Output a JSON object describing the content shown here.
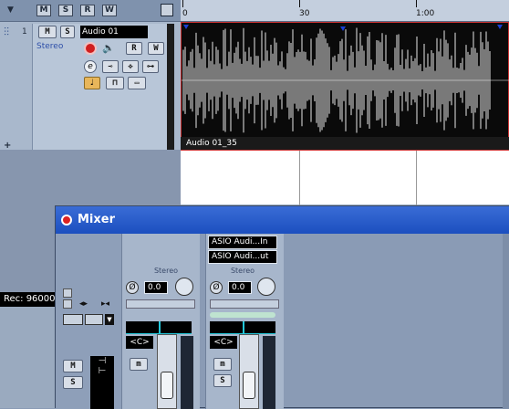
{
  "project": {
    "toolbar": {
      "buttons": [
        "M",
        "S",
        "R",
        "W"
      ]
    },
    "timeline": {
      "ticks": [
        "0",
        "30",
        "1:00"
      ]
    },
    "track": {
      "number": "1",
      "name": "Audio 01",
      "channel_type": "Stereo",
      "mute": "M",
      "solo": "S",
      "read": "R",
      "write": "W",
      "edit": "e"
    },
    "part_label": "Audio 01_35",
    "status": "Rec: 96000"
  },
  "mixer": {
    "title": "Mixer",
    "left_panel": {
      "buttons": [
        "M",
        "S"
      ]
    },
    "channels": [
      {
        "stereo_label": "Stereo",
        "phase_value": "0.0",
        "pan_label": "<C>",
        "mute": "m"
      },
      {
        "input_route": "ASIO Audi...In",
        "output_route": "ASIO Audi...ut",
        "stereo_label": "Stereo",
        "phase_value": "0.0",
        "pan_label": "<C>",
        "mute": "m",
        "solo": "S"
      }
    ]
  },
  "colors": {
    "title_bar": "#2a5bd0",
    "accent_cyan": "#23c7d9",
    "record_red": "#d01f1f"
  }
}
